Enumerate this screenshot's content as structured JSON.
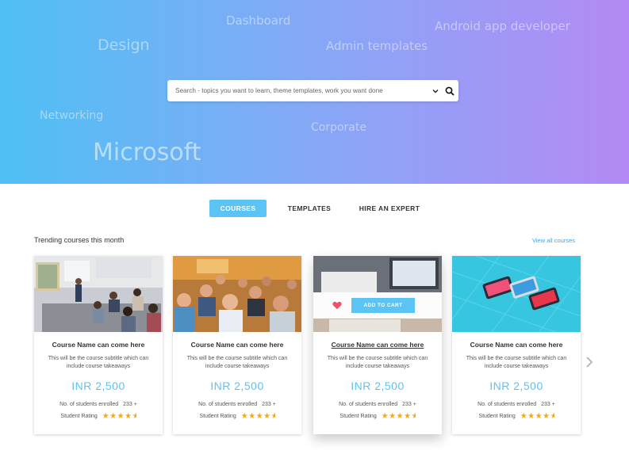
{
  "hero": {
    "tag_words": [
      "Dashboard",
      "Design",
      "Admin templates",
      "Android app developer",
      "Networking",
      "Corporate",
      "Microsoft"
    ],
    "search": {
      "placeholder": "Search - topics you want to learn, theme templates, work you want done"
    },
    "colors": {
      "gradient_start": "#4fc0f4",
      "gradient_end": "#b48af5"
    }
  },
  "tabs": [
    {
      "label": "COURSES",
      "active": true
    },
    {
      "label": "TEMPLATES",
      "active": false
    },
    {
      "label": "HIRE AN EXPERT",
      "active": false
    }
  ],
  "section": {
    "title": "Trending courses this month",
    "view_all": "View all courses"
  },
  "cards": [
    {
      "name": "Course Name can come here",
      "subtitle": "This will be the course subtitle which can include course takeaways",
      "price": "INR 2,500",
      "enrolled_label": "No. of students enrolled",
      "enrolled_count": "233 +",
      "rating_label": "Student Rating",
      "rating": 4.5
    },
    {
      "name": "Course Name can come here",
      "subtitle": "This will be the course subtitle which can include course takeaways",
      "price": "INR 2,500",
      "enrolled_label": "No. of students enrolled",
      "enrolled_count": "233 +",
      "rating_label": "Student Rating",
      "rating": 4.5
    },
    {
      "name": "Course Name can come here",
      "subtitle": "This will be the course subtitle which can include course takeaways",
      "price": "INR 2,500",
      "enrolled_label": "No. of students enrolled",
      "enrolled_count": "233 +",
      "rating_label": "Student Rating",
      "rating": 4.5,
      "add_to_cart": "ADD TO CART"
    },
    {
      "name": "Course Name can come here",
      "subtitle": "This will be the course subtitle which can include course takeaways",
      "price": "INR 2,500",
      "enrolled_label": "No. of students enrolled",
      "enrolled_count": "233 +",
      "rating_label": "Student Rating",
      "rating": 4.5
    }
  ],
  "icons": {
    "search": "search-icon",
    "dropdown": "chevron-down-icon",
    "heart": "heart-icon",
    "next": "chevron-right-icon",
    "star": "star-icon"
  },
  "accent_color": "#5bc4f4"
}
